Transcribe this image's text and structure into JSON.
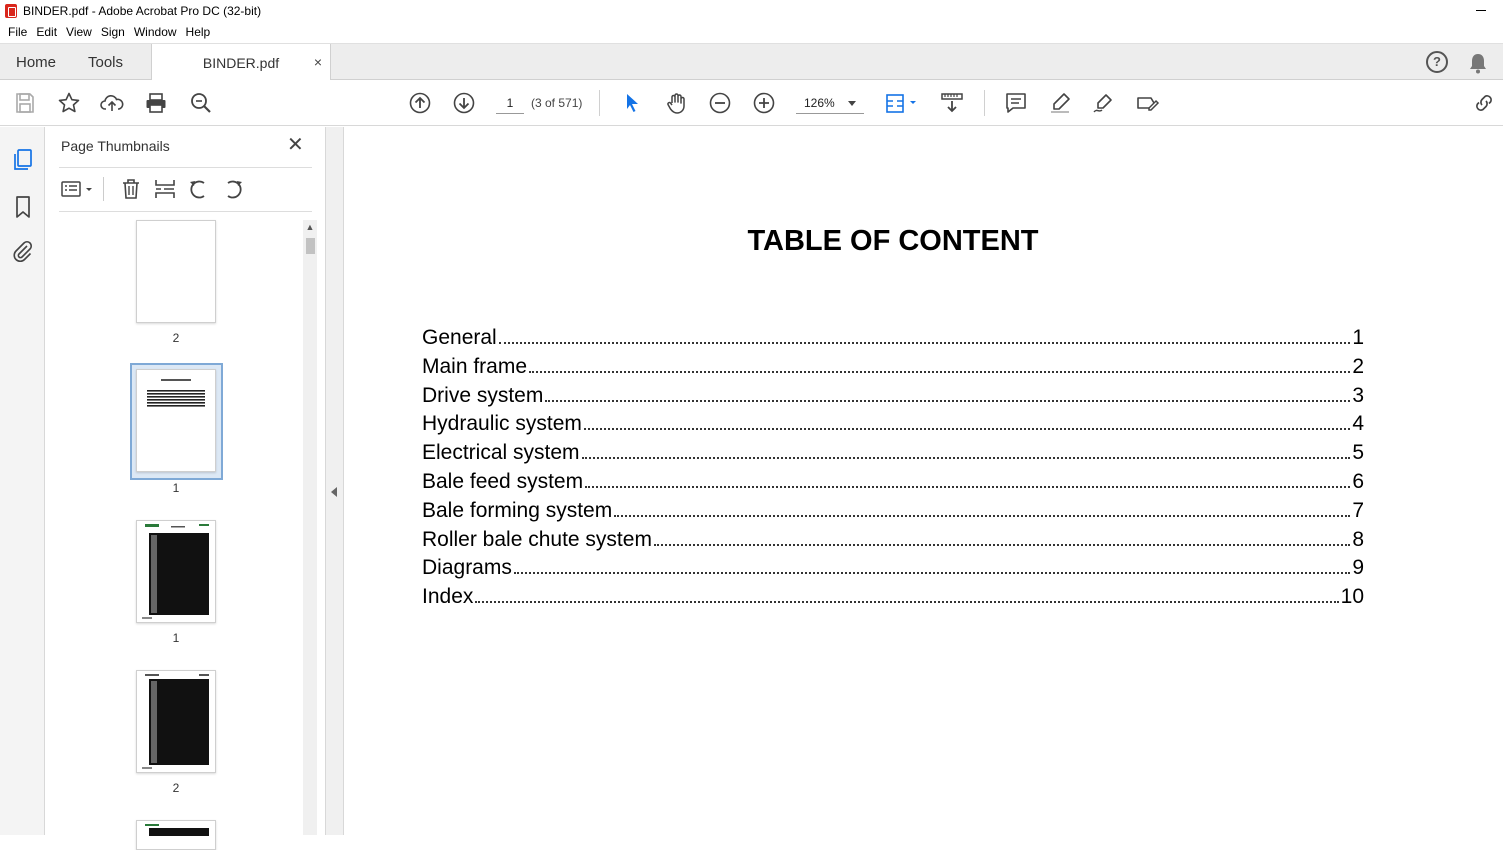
{
  "window": {
    "title": "BINDER.pdf - Adobe Acrobat Pro DC (32-bit)"
  },
  "menu": [
    "File",
    "Edit",
    "View",
    "Sign",
    "Window",
    "Help"
  ],
  "tabs": {
    "home": "Home",
    "tools": "Tools",
    "document": "BINDER.pdf",
    "close_glyph": "×"
  },
  "toolbar": {
    "page_number": "1",
    "page_count": "(3 of 571)",
    "zoom": "126%"
  },
  "thumbnails_panel": {
    "title": "Page Thumbnails",
    "close_glyph": "✕",
    "thumbs": [
      {
        "label": "2",
        "selected": false
      },
      {
        "label": "1",
        "selected": true
      },
      {
        "label": "1",
        "selected": false
      },
      {
        "label": "2",
        "selected": false
      }
    ]
  },
  "document": {
    "title": "TABLE OF CONTENT",
    "toc": [
      {
        "label": "General",
        "page": "1"
      },
      {
        "label": "Main frame",
        "page": "2"
      },
      {
        "label": "Drive system",
        "page": "3"
      },
      {
        "label": "Hydraulic system",
        "page": "4"
      },
      {
        "label": "Electrical system",
        "page": "5"
      },
      {
        "label": "Bale feed system",
        "page": "6"
      },
      {
        "label": "Bale forming system",
        "page": "7"
      },
      {
        "label": "Roller bale chute system",
        "page": "8"
      },
      {
        "label": "Diagrams",
        "page": "9"
      },
      {
        "label": "Index",
        "page": "10"
      }
    ]
  },
  "colors": {
    "accent": "#1473e6",
    "pdf_icon": "#d9261c"
  }
}
